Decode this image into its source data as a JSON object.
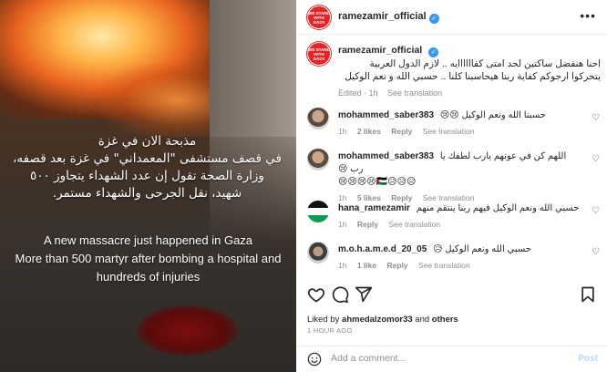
{
  "media": {
    "arabic_lines": [
      "مذبحة الان في غزة",
      "في قصف مستشفى \"المعمداني\" في غزة بعد قصفه،",
      "وزارة الصحة تقول إن عدد الشهداء يتجاوز ٥٠٠",
      "شهيد، نقل الجرحى والشهداء مستمر."
    ],
    "english_lines": [
      "A new massacre just happened in Gaza",
      "More than 500 martyr after bombing a hospital and",
      "hundreds of injuries"
    ]
  },
  "header": {
    "username": "ramezamir_official",
    "avatar_text": [
      "WE STAND",
      "WITH GAZA"
    ],
    "more_icon": "more-horizontal-icon"
  },
  "caption": {
    "username": "ramezamir_official",
    "text": "احنا هنفضل ساكتين لحد امتى كفاااااايه .. لازم الدول العربية يتحركوا ارجوكم كفاية ربنا هيحاسبنا كلنا .. حسبي الله و نعم الوكيل",
    "edited": "Edited · 1h",
    "see_translation": "See translation"
  },
  "comments": [
    {
      "username": "mohammed_saber383",
      "text": "حسبنا الله ونعم الوكيل 😢😢",
      "time": "1h",
      "likes": "2 likes",
      "reply": "Reply",
      "see_translation": "See translation"
    },
    {
      "username": "mohammed_saber383",
      "text": "اللهم كن في عونهم يارب لطفك يا رب 😢",
      "text2": "😢😢😢😢🇵🇸😥😥😥",
      "time": "1h",
      "likes": "5 likes",
      "reply": "Reply",
      "see_translation": "See translation"
    },
    {
      "username": "hana_ramezamir",
      "text": "حسبي الله ونعم الوكيل فيهم ربنا ينتقم منهم",
      "time": "1h",
      "likes": "",
      "reply": "Reply",
      "see_translation": "See translation"
    },
    {
      "username": "m.o.h.a.m.e.d_20_05",
      "text": "حسبي الله ونعم الوكيل 😥",
      "time": "1h",
      "likes": "1 like",
      "reply": "Reply",
      "see_translation": "See translation"
    }
  ],
  "actions": {
    "icons": [
      "heart-icon",
      "comment-icon",
      "share-icon",
      "bookmark-icon"
    ]
  },
  "likes": {
    "prefix": "Liked by ",
    "user": "ahmedalzomor33",
    "middle": " and ",
    "others": "others"
  },
  "time_ago": "1 HOUR AGO",
  "add_comment": {
    "placeholder": "Add a comment...",
    "post": "Post"
  },
  "colors": {
    "accent": "#3897f0",
    "avatar_red": "#e0262b",
    "muted": "#8e8e8e"
  }
}
